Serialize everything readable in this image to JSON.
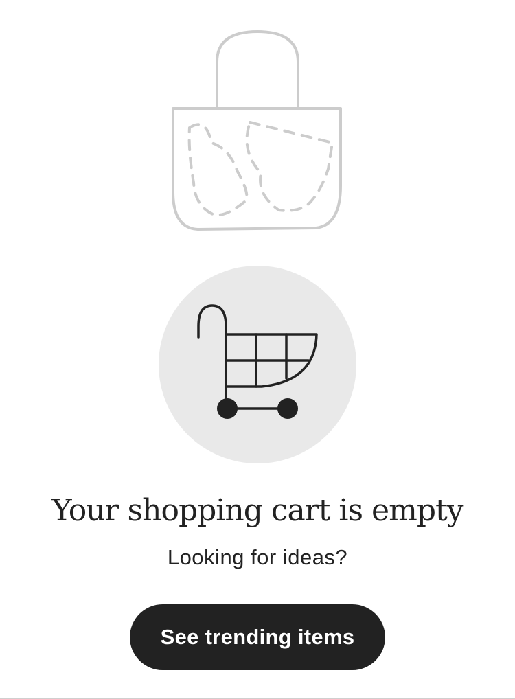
{
  "illustration": {
    "icon": "empty-bag-illustration"
  },
  "cart_badge": {
    "icon": "shopping-cart-icon",
    "background": "#e9e9e9"
  },
  "empty_state": {
    "title": "Your shopping cart is empty",
    "subtitle": "Looking for ideas?"
  },
  "cta": {
    "label": "See trending items",
    "background": "#222222",
    "text_color": "#ffffff"
  }
}
